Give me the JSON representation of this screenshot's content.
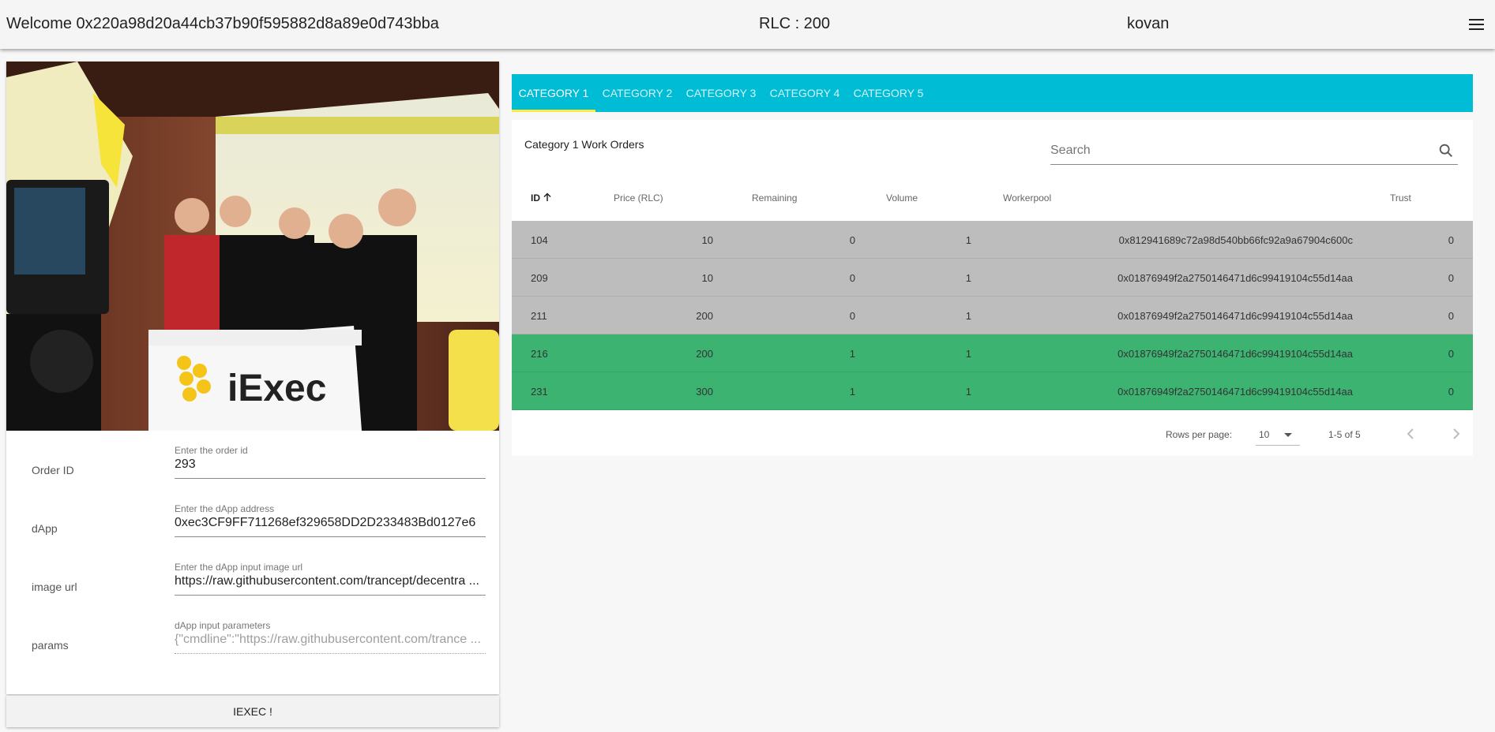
{
  "header": {
    "welcome": "Welcome 0x220a98d20a44cb37b90f595882d8a89e0d743bba",
    "rlc": "RLC : 200",
    "network": "kovan",
    "menu_icon": "menu-icon"
  },
  "left": {
    "photo_alt": "iExec team at BlockShow Asia 2017",
    "form": {
      "order_id": {
        "label": "Order ID",
        "hint": "Enter the order id",
        "value": "293"
      },
      "dapp": {
        "label": "dApp",
        "hint": "Enter the dApp address",
        "value": "0xec3CF9FF711268ef329658DD2D233483Bd0127e6"
      },
      "image_url": {
        "label": "image url",
        "hint": "Enter the dApp input image url",
        "value": "https://raw.githubusercontent.com/trancept/decentra ..."
      },
      "params": {
        "label": "params",
        "hint": "dApp input parameters",
        "value": "{\"cmdline\":\"https://raw.githubusercontent.com/trance ..."
      }
    },
    "submit_label": "IEXEC !"
  },
  "tabs": [
    "CATEGORY 1",
    "CATEGORY 2",
    "CATEGORY 3",
    "CATEGORY 4",
    "CATEGORY 5"
  ],
  "active_tab": 0,
  "table": {
    "title": "Category 1 Work Orders",
    "search_placeholder": "Search",
    "columns": {
      "id": "ID",
      "price": "Price (RLC)",
      "remaining": "Remaining",
      "volume": "Volume",
      "workerpool": "Workerpool",
      "trust": "Trust"
    },
    "sort_icon": "arrow-up-icon",
    "rows": [
      {
        "id": "104",
        "price": "10",
        "remaining": "0",
        "volume": "1",
        "workerpool": "0x812941689c72a98d540bb66fc92a9a67904c600c",
        "trust": "0",
        "status": "inactive"
      },
      {
        "id": "209",
        "price": "10",
        "remaining": "0",
        "volume": "1",
        "workerpool": "0x01876949f2a2750146471d6c99419104c55d14aa",
        "trust": "0",
        "status": "inactive"
      },
      {
        "id": "211",
        "price": "200",
        "remaining": "0",
        "volume": "1",
        "workerpool": "0x01876949f2a2750146471d6c99419104c55d14aa",
        "trust": "0",
        "status": "inactive"
      },
      {
        "id": "216",
        "price": "200",
        "remaining": "1",
        "volume": "1",
        "workerpool": "0x01876949f2a2750146471d6c99419104c55d14aa",
        "trust": "0",
        "status": "active"
      },
      {
        "id": "231",
        "price": "300",
        "remaining": "1",
        "volume": "1",
        "workerpool": "0x01876949f2a2750146471d6c99419104c55d14aa",
        "trust": "0",
        "status": "active"
      }
    ],
    "footer": {
      "rows_per_page_label": "Rows per page:",
      "rows_per_page": "10",
      "range": "1-5 of 5"
    }
  },
  "colors": {
    "tab_bar": "#00bcd4",
    "tab_indicator": "#ffeb3b",
    "row_inactive": "#bdbdbd",
    "row_active": "#3cb371"
  }
}
